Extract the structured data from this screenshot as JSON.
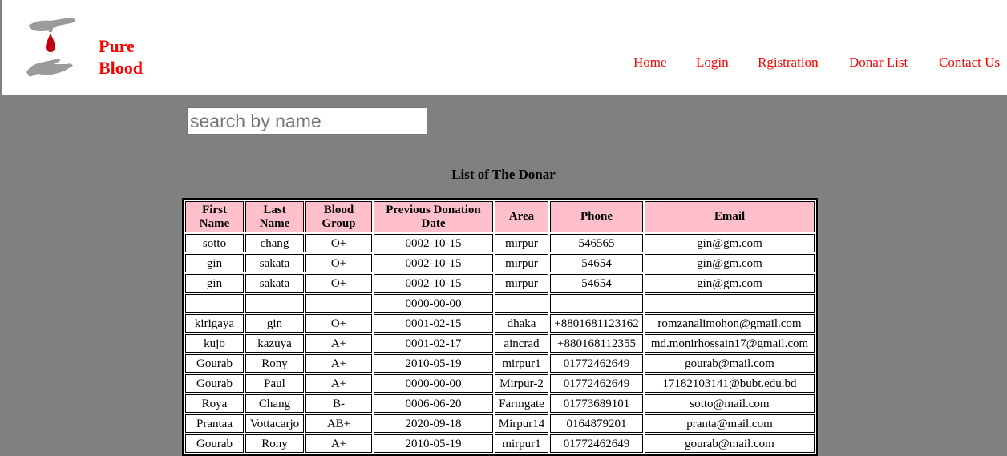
{
  "brand": {
    "line1": "Pure",
    "line2": "Blood",
    "icon": "blood-drop-hands-icon"
  },
  "nav": [
    "Home",
    "Login",
    "Rgistration",
    "Donar List",
    "Contact Us"
  ],
  "search": {
    "placeholder": "search by name",
    "value": ""
  },
  "list_title": "List of The Donar",
  "colors": {
    "accent": "#ff0000",
    "header_cell": "#ffc0cb",
    "page_bg": "#808080"
  },
  "table": {
    "headers": [
      [
        "First",
        "Name"
      ],
      [
        "Last",
        "Name"
      ],
      [
        "Blood",
        "Group"
      ],
      [
        "Previous Donation",
        "Date"
      ],
      [
        "Area"
      ],
      [
        "Phone"
      ],
      [
        "Email"
      ]
    ],
    "rows": [
      [
        "sotto",
        "chang",
        "O+",
        "0002-10-15",
        "mirpur",
        "546565",
        "gin@gm.com"
      ],
      [
        "gin",
        "sakata",
        "O+",
        "0002-10-15",
        "mirpur",
        "54654",
        "gin@gm.com"
      ],
      [
        "gin",
        "sakata",
        "O+",
        "0002-10-15",
        "mirpur",
        "54654",
        "gin@gm.com"
      ],
      [
        "",
        "",
        "",
        "0000-00-00",
        "",
        "",
        ""
      ],
      [
        "kirigaya",
        "gin",
        "O+",
        "0001-02-15",
        "dhaka",
        "+8801681123162",
        "romzanalimohon@gmail.com"
      ],
      [
        "kujo",
        "kazuya",
        "A+",
        "0001-02-17",
        "aincrad",
        "+880168112355",
        "md.monirhossain17@gmail.com"
      ],
      [
        "Gourab",
        "Rony",
        "A+",
        "2010-05-19",
        "mirpur1",
        "01772462649",
        "gourab@mail.com"
      ],
      [
        "Gourab",
        "Paul",
        "A+",
        "0000-00-00",
        "Mirpur-2",
        "01772462649",
        "17182103141@bubt.edu.bd"
      ],
      [
        "Roya",
        "Chang",
        "B-",
        "0006-06-20",
        "Farmgate",
        "01773689101",
        "sotto@mail.com"
      ],
      [
        "Prantaa",
        "Vottacarjo",
        "AB+",
        "2020-09-18",
        "Mirpur14",
        "0164879201",
        "pranta@mail.com"
      ],
      [
        "Gourab",
        "Rony",
        "A+",
        "2010-05-19",
        "mirpur1",
        "01772462649",
        "gourab@mail.com"
      ]
    ]
  }
}
